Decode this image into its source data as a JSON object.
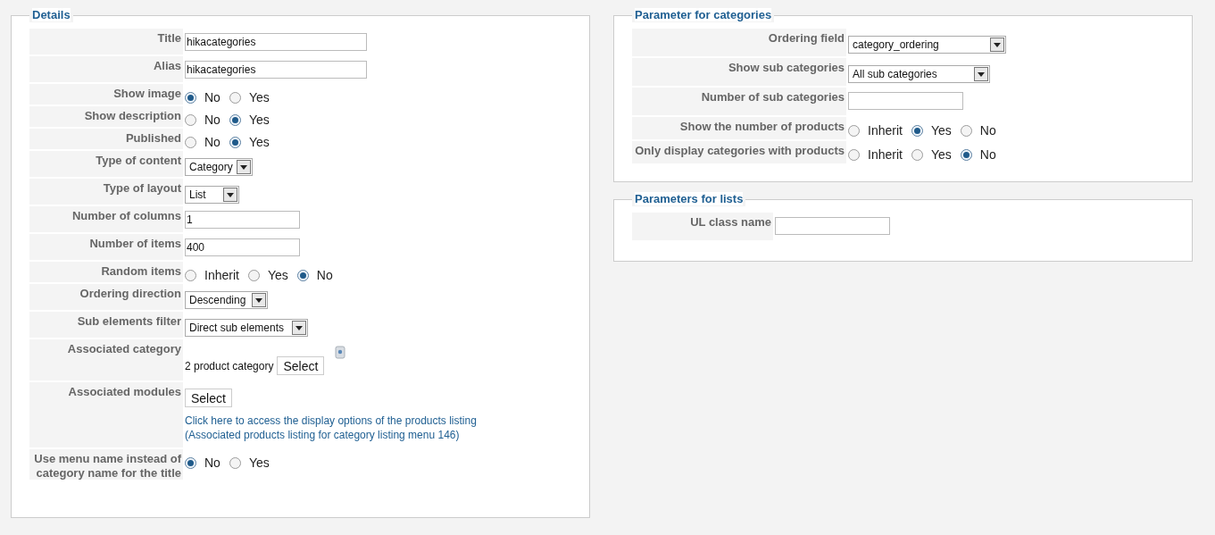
{
  "details": {
    "legend": "Details",
    "rows": [
      {
        "kind": "text",
        "label": "Title",
        "value": "hikacategories"
      },
      {
        "kind": "text",
        "label": "Alias",
        "value": "hikacategories"
      },
      {
        "kind": "radio",
        "label": "Show image",
        "options": [
          {
            "label": "No",
            "selected": true
          },
          {
            "label": "Yes",
            "selected": false
          }
        ]
      },
      {
        "kind": "radio",
        "label": "Show description",
        "options": [
          {
            "label": "No",
            "selected": false
          },
          {
            "label": "Yes",
            "selected": true
          }
        ]
      },
      {
        "kind": "radio",
        "label": "Published",
        "options": [
          {
            "label": "No",
            "selected": false
          },
          {
            "label": "Yes",
            "selected": true
          }
        ]
      },
      {
        "kind": "select",
        "label": "Type of content",
        "value": "Category"
      },
      {
        "kind": "select",
        "label": "Type of layout",
        "value": "List"
      },
      {
        "kind": "text",
        "label": "Number of columns",
        "value": "1"
      },
      {
        "kind": "text",
        "label": "Number of items",
        "value": "400"
      },
      {
        "kind": "radio",
        "label": "Random items",
        "options": [
          {
            "label": "Inherit",
            "selected": false
          },
          {
            "label": "Yes",
            "selected": false
          },
          {
            "label": "No",
            "selected": true
          }
        ]
      },
      {
        "kind": "select",
        "label": "Ordering direction",
        "value": "Descending"
      },
      {
        "kind": "select",
        "label": "Sub elements filter",
        "value": "Direct sub elements"
      },
      {
        "kind": "category",
        "label": "Associated category",
        "value": "2 product category",
        "button": "Select"
      },
      {
        "kind": "modules",
        "label": "Associated modules",
        "button": "Select",
        "link": "Click here to access the display options of the products listing",
        "note": "(Associated products listing for category listing menu 146)"
      },
      {
        "kind": "radio",
        "label": "Use menu name instead of category name for the title",
        "options": [
          {
            "label": "No",
            "selected": true
          },
          {
            "label": "Yes",
            "selected": false
          }
        ]
      }
    ]
  },
  "categories": {
    "legend": "Parameter for categories",
    "rows": [
      {
        "kind": "select",
        "label": "Ordering field",
        "value": "category_ordering"
      },
      {
        "kind": "select",
        "label": "Show sub categories",
        "value": "All sub categories"
      },
      {
        "kind": "text",
        "label": "Number of sub categories",
        "value": ""
      },
      {
        "kind": "radio",
        "label": "Show the number of products",
        "options": [
          {
            "label": "Inherit",
            "selected": false
          },
          {
            "label": "Yes",
            "selected": true
          },
          {
            "label": "No",
            "selected": false
          }
        ]
      },
      {
        "kind": "radio",
        "label": "Only display categories with products",
        "options": [
          {
            "label": "Inherit",
            "selected": false
          },
          {
            "label": "Yes",
            "selected": false
          },
          {
            "label": "No",
            "selected": true
          }
        ]
      }
    ]
  },
  "lists": {
    "legend": "Parameters for lists",
    "rows": [
      {
        "kind": "text",
        "label": "UL class name",
        "value": ""
      }
    ]
  }
}
